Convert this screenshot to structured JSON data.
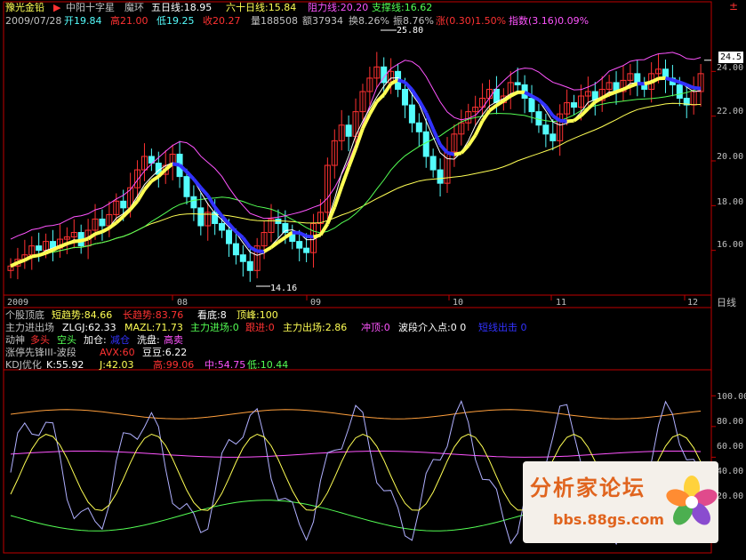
{
  "header": {
    "stock_name": "豫光金铅",
    "indicator_name": "中阳十字星",
    "pattern": "魔环",
    "ma5": "五日线:18.95",
    "ma60": "六十日线:15.84",
    "resistance": "阻力线:20.20",
    "support": "支撑线:16.62",
    "date": "2009/07/28",
    "open": "开19.84",
    "high": "高21.00",
    "low": "低19.25",
    "close": "收20.27",
    "volume": "量188508",
    "amount": "额37934",
    "turnover": "换8.26%",
    "amplitude": "振8.76%",
    "change": "涨(0.30)1.50%",
    "index": "指数(3.16)0.09%",
    "top_right": "±"
  },
  "main_chart": {
    "price_ticks": [
      "24.00",
      "22.00",
      "20.00",
      "18.00",
      "16.00"
    ],
    "current_price": "24.5",
    "high_label": "25.80",
    "low_label": "14.16",
    "month_labels": [
      "2009",
      "08",
      "09",
      "10",
      "11",
      "12"
    ],
    "period": "日线"
  },
  "indicator_rows": {
    "row1": {
      "name": "个股顶底",
      "a": "短趋势:84.66",
      "b": "长趋势:83.76",
      "c": "看底:8",
      "d": "顶峰:100"
    },
    "row2": {
      "name": "主力进出场",
      "a": "ZLGJ:62.33",
      "b": "MAZL:71.73",
      "c": "主力进场:0",
      "d": "跟进:0",
      "e": "主力出场:2.86",
      "f": "冲顶:0",
      "g": "波段介入点:0 0",
      "h": "短线出击 0"
    },
    "row3": {
      "name": "动神",
      "a": "多头",
      "b": "空头",
      "c": "加仓:",
      "d": "减仓",
      "e": "洗盘:",
      "f": "高卖"
    },
    "row4": {
      "name": "涨停先锋III-波段",
      "a": "AVX:60",
      "b": "豆豆:6.22"
    },
    "row5": {
      "name": "KDJ优化",
      "k": "K:55.92",
      "j": "J:42.03",
      "high": "高:99.06",
      "mid": "中:54.75",
      "low": "低:10.44"
    }
  },
  "kdj_ticks": [
    "100.00",
    "80.00",
    "60.00",
    "40.00",
    "20.00"
  ],
  "watermark": {
    "title": "分析家论坛",
    "url": "bbs.88gs.com"
  },
  "colors": {
    "up": "#ff3232",
    "down": "#54fcfc",
    "yellow": "#ffff54",
    "blue": "#3232ff",
    "magenta": "#ff54ff",
    "green": "#54ff54",
    "white": "#ffffff",
    "axis": "#c00000"
  },
  "chart_data": {
    "type": "candlestick",
    "title": "豫光金铅",
    "ylim": [
      14,
      26
    ],
    "closes": [
      15.3,
      15.6,
      15.8,
      16.2,
      16.0,
      16.4,
      16.1,
      16.5,
      16.6,
      16.8,
      16.2,
      16.9,
      17.4,
      17.1,
      17.6,
      18.2,
      17.9,
      18.8,
      19.6,
      20.2,
      19.9,
      19.4,
      19.8,
      20.3,
      19.3,
      18.4,
      17.9,
      17.1,
      17.7,
      17.2,
      16.9,
      16.3,
      15.8,
      15.5,
      15.1,
      16.2,
      16.8,
      17.4,
      17.2,
      16.8,
      16.4,
      16.1,
      15.9,
      17.2,
      17.7,
      19.8,
      20.9,
      21.6,
      21.1,
      22.2,
      23.1,
      23.7,
      24.2,
      23.5,
      24.0,
      23.2,
      22.5,
      21.7,
      21.3,
      20.2,
      19.6,
      19.0,
      20.4,
      21.2,
      21.7,
      22.2,
      22.4,
      22.8,
      23.2,
      22.6,
      22.9,
      23.5,
      23.4,
      22.8,
      22.2,
      21.6,
      21.2,
      20.9,
      22.1,
      22.6,
      22.4,
      22.9,
      23.1,
      22.7,
      23.2,
      23.5,
      23.1,
      23.6,
      23.9,
      23.4,
      23.2,
      23.9,
      24.1,
      23.7,
      23.4,
      22.8,
      22.5,
      23.1,
      23.9
    ],
    "kdj": {
      "K": 55.92,
      "J": 42.03,
      "high": 99.06,
      "mid": 54.75,
      "low": 10.44
    },
    "kdj_ylim": [
      0,
      110
    ]
  }
}
